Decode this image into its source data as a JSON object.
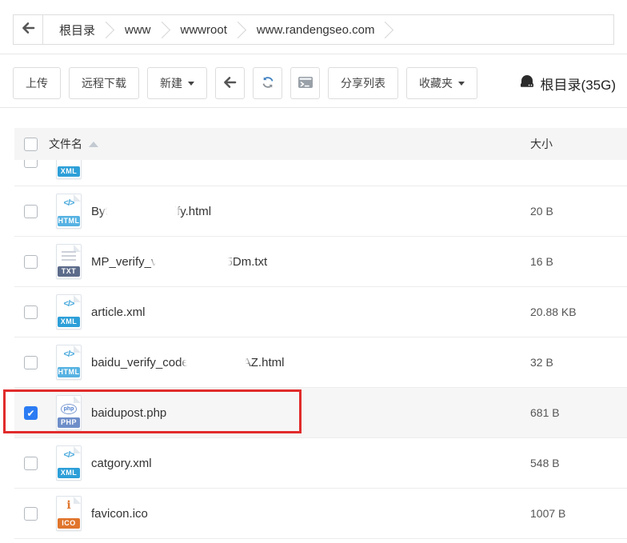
{
  "breadcrumb": {
    "items": [
      "根目录",
      "www",
      "wwwroot",
      "www.randengseo.com"
    ]
  },
  "toolbar": {
    "upload": "上传",
    "remote_download": "远程下载",
    "new": "新建",
    "share_list": "分享列表",
    "favorites": "收藏夹",
    "disk_label": "根目录(35G)"
  },
  "table": {
    "columns": {
      "name": "文件名",
      "size": "大小"
    },
    "rows": [
      {
        "type": "xml",
        "icon": "XML",
        "partial": true,
        "name_prefix": "",
        "size": ""
      },
      {
        "type": "html",
        "icon": "HTML",
        "name_prefix": "Byt",
        "redacted_width": 88,
        "name_suffix": "ify.html",
        "size": "20 B"
      },
      {
        "type": "txt",
        "icon": "TXT",
        "name_prefix": "MP_verify_v",
        "redacted_width": 92,
        "name_suffix": "5Dm.txt",
        "size": "16 B"
      },
      {
        "type": "xml",
        "icon": "XML",
        "name_prefix": "article.xml",
        "size": "20.88 KB"
      },
      {
        "type": "html",
        "icon": "HTML",
        "name_prefix": "baidu_verify_code",
        "redacted_width": 74,
        "name_suffix": "AZ.html",
        "size": "32 B"
      },
      {
        "type": "php",
        "icon": "PHP",
        "name_prefix": "baidupost.php",
        "size": "681 B",
        "checked": true,
        "highlighted": true
      },
      {
        "type": "xml",
        "icon": "XML",
        "name_prefix": "catgory.xml",
        "size": "548 B"
      },
      {
        "type": "ico",
        "icon": "ICO",
        "name_prefix": "favicon.ico",
        "size": "1007 B"
      }
    ]
  },
  "colors": {
    "highlight_box_red": "#e12b2b",
    "checkbox_checked_blue": "#2b7bf3",
    "xml_banner": "#2d9fd8",
    "html_banner": "#56b2e2",
    "txt_banner": "#5c6b8a",
    "php_banner": "#6e8ec9",
    "ico_banner": "#e0752c"
  }
}
